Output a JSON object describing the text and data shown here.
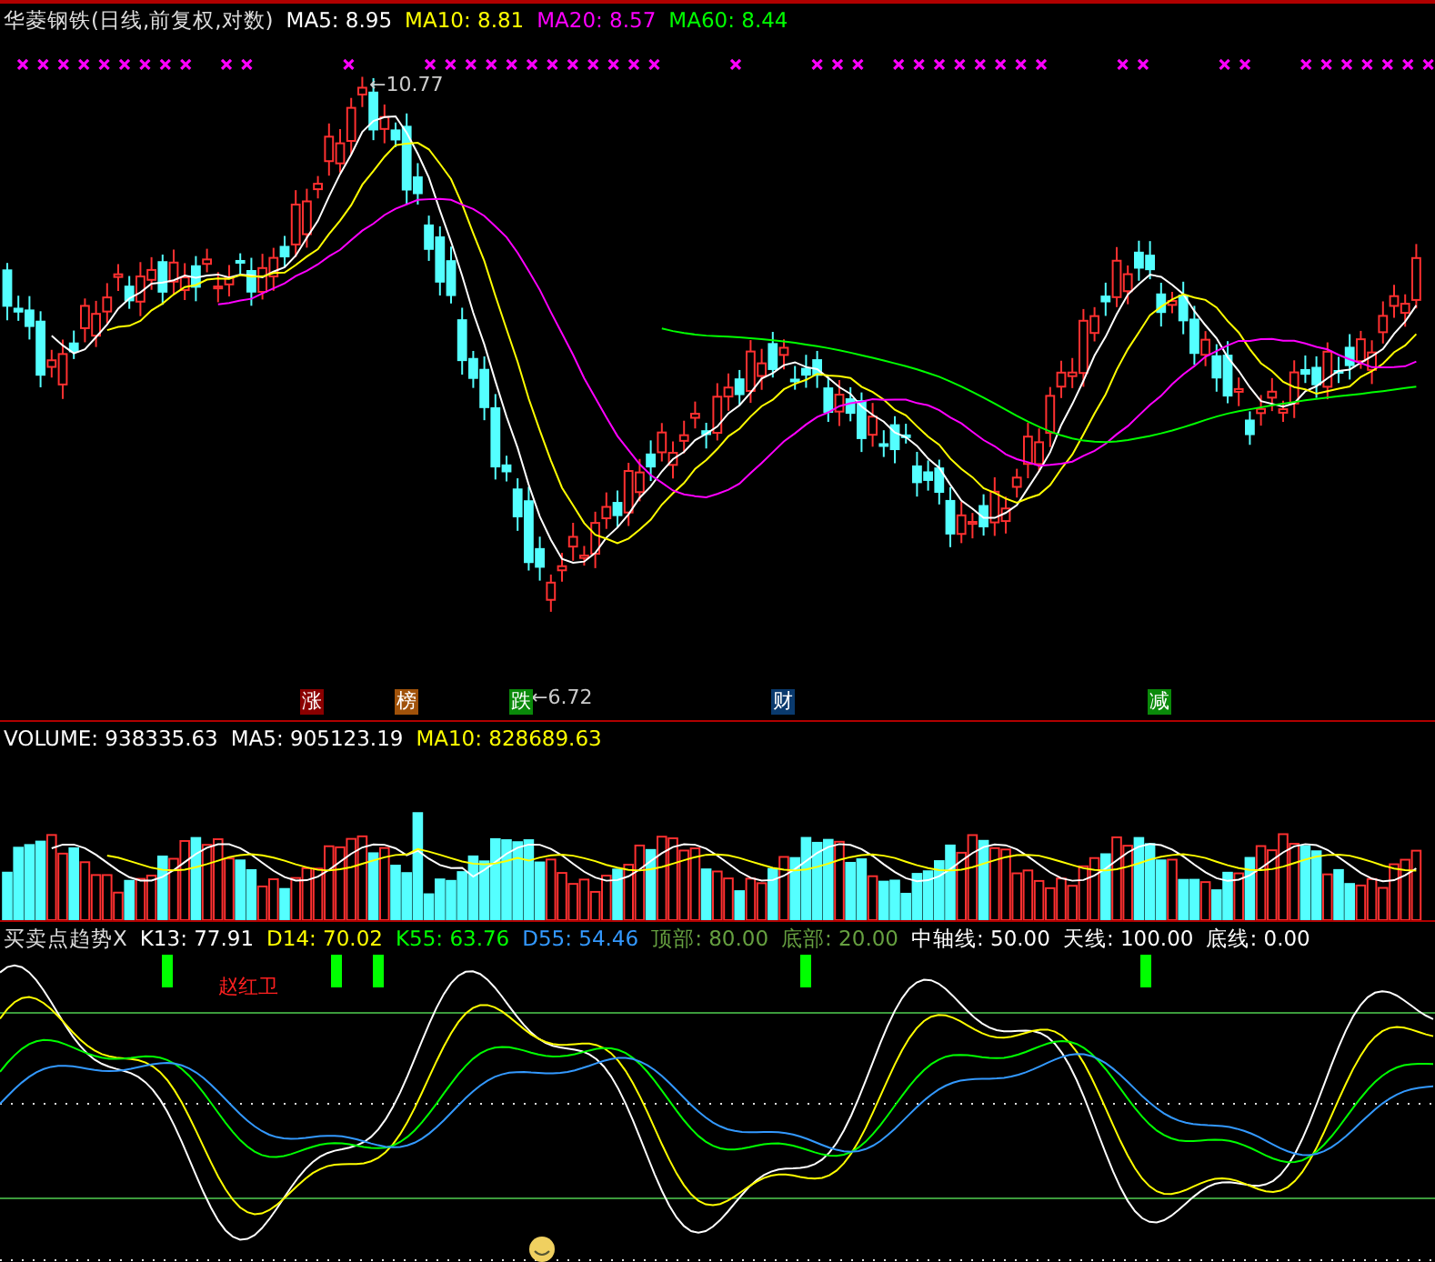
{
  "price_panel": {
    "title": "华菱钢铁(日线,前复权,对数)",
    "indicators": [
      {
        "text": "MA5: 8.95",
        "color": "#ffffff"
      },
      {
        "text": "MA10: 8.81",
        "color": "#ffff00"
      },
      {
        "text": "MA20: 8.57",
        "color": "#ff00ff"
      },
      {
        "text": "MA60: 8.44",
        "color": "#00ff00"
      }
    ],
    "high_label": "←10.77",
    "low_label": "←6.72",
    "event_tags": [
      {
        "text": "涨",
        "color": "#8b0000"
      },
      {
        "text": "榜",
        "color": "#a0520a"
      },
      {
        "text": "跌",
        "color": "#0a8a0a"
      },
      {
        "text": "财",
        "color": "#0a3a6e"
      },
      {
        "text": "减",
        "color": "#0a8a0a"
      }
    ]
  },
  "volume_panel": {
    "indicators": [
      {
        "text": "VOLUME: 938335.63",
        "color": "#ffffff"
      },
      {
        "text": "MA5: 905123.19",
        "color": "#ffffff"
      },
      {
        "text": "MA10: 828689.63",
        "color": "#ffff00"
      }
    ]
  },
  "signal_panel": {
    "title": "买卖点趋势X",
    "indicators": [
      {
        "text": "K13: 77.91",
        "color": "#ffffff"
      },
      {
        "text": "D14: 70.02",
        "color": "#ffff00"
      },
      {
        "text": "K55: 63.76",
        "color": "#00ff00"
      },
      {
        "text": "D55: 54.46",
        "color": "#3399ff"
      },
      {
        "text": "顶部: 80.00",
        "color": "#66a040"
      },
      {
        "text": "底部: 20.00",
        "color": "#66a040"
      },
      {
        "text": "中轴线: 50.00",
        "color": "#ffffff"
      },
      {
        "text": "天线: 100.00",
        "color": "#ffffff"
      },
      {
        "text": "底线: 0.00",
        "color": "#ffffff"
      }
    ],
    "note": "赵红卫"
  }
}
